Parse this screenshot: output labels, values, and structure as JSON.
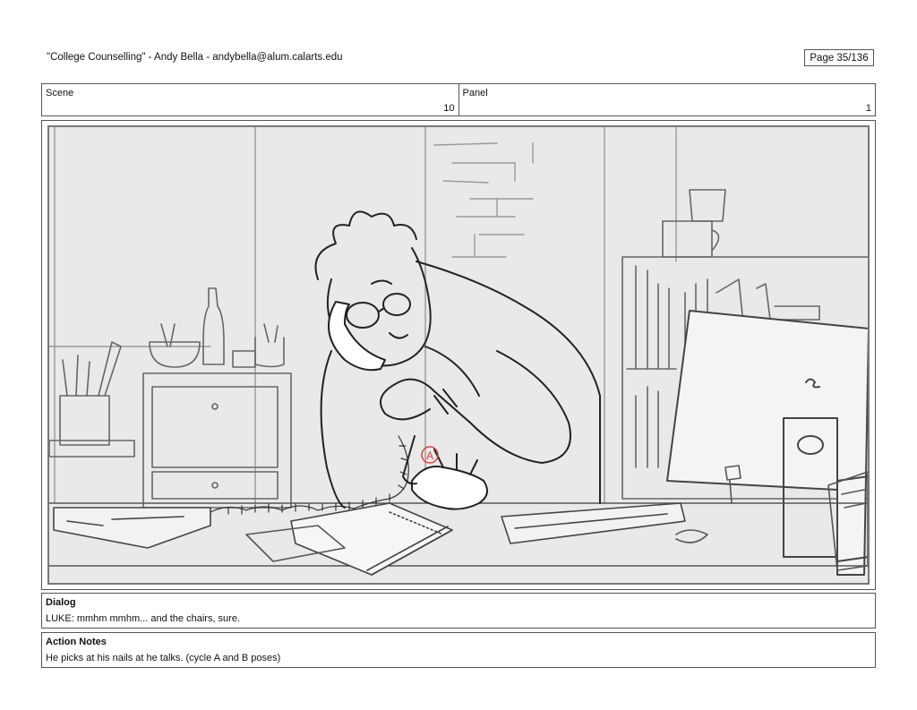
{
  "header": {
    "title": "\"College Counselling\"  -  Andy Bella  -   andybella@alum.calarts.edu",
    "page": "Page  35/136"
  },
  "scene": {
    "label": "Scene",
    "value": "10"
  },
  "panel": {
    "label": "Panel",
    "value": "1"
  },
  "dialog": {
    "title": "Dialog",
    "text": "LUKE: mmhm mmhm... and the chairs, sure."
  },
  "action_notes": {
    "title": "Action Notes",
    "text": "He picks at his nails at he talks. (cycle A and B poses)"
  },
  "sketch_marker": "A"
}
